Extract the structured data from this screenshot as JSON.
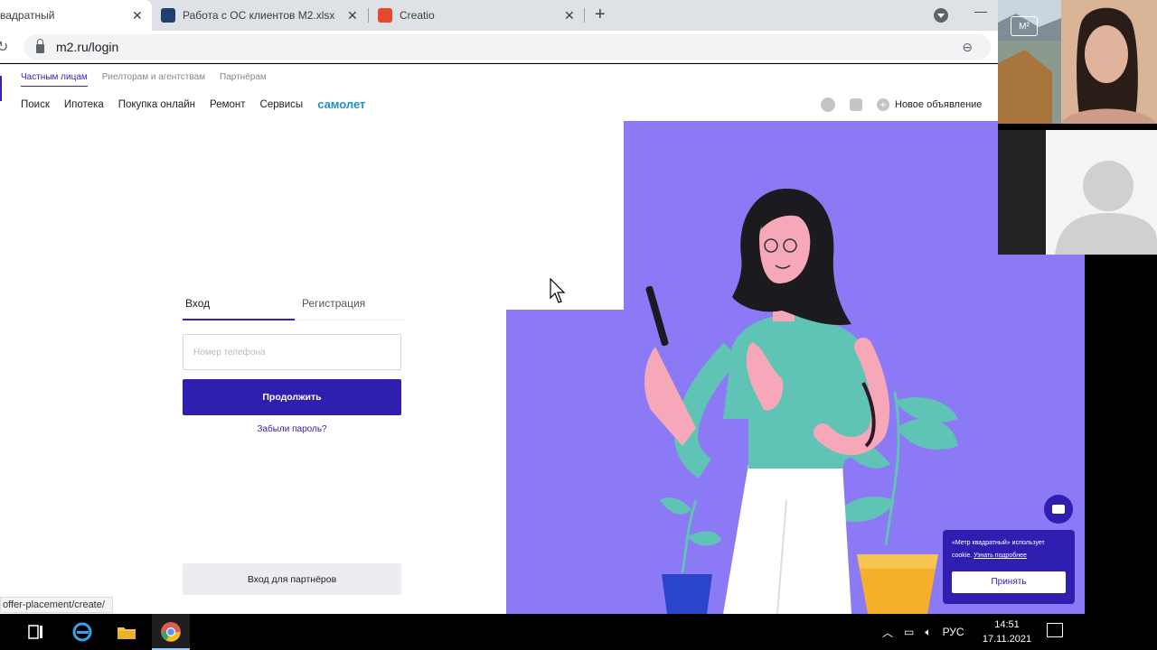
{
  "browser": {
    "tabs": [
      {
        "title": "вадратный",
        "active": true
      },
      {
        "title": "Работа с ОС клиентов M2.xlsx - ",
        "active": false
      },
      {
        "title": "Creatio",
        "active": false
      }
    ],
    "url": "m2.ru/login",
    "status_url": "offer-placement/create/"
  },
  "site": {
    "segments": [
      "Частным лицам",
      "Риелторам и агентствам",
      "Партнёрам"
    ],
    "nav": [
      "Поиск",
      "Ипотека",
      "Покупка онлайн",
      "Ремонт",
      "Сервисы"
    ],
    "brand": "самолет",
    "new_ad": "Новое объявление"
  },
  "login": {
    "tab_login": "Вход",
    "tab_register": "Регистрация",
    "phone_placeholder": "Номер телефона",
    "continue": "Продолжить",
    "forgot": "Забыли пароль?",
    "partner_login": "Вход для партнёров"
  },
  "cookie": {
    "text": "«Метр квадратный» использует cookie.",
    "more": "Узнать подробнее",
    "accept": "Принять"
  },
  "video": {
    "logo": "M²"
  },
  "taskbar": {
    "lang": "РУС",
    "time": "14:51",
    "date": "17.11.2021"
  },
  "colors": {
    "accent": "#2f1fb0",
    "illustration_bg": "#8b79f5",
    "brand_blue": "#1e8fd0"
  }
}
